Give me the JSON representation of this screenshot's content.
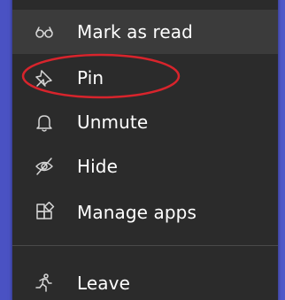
{
  "menu": {
    "items": [
      {
        "label": "Mark as read",
        "icon": "glasses-icon"
      },
      {
        "label": "Pin",
        "icon": "pin-icon"
      },
      {
        "label": "Unmute",
        "icon": "bell-icon"
      },
      {
        "label": "Hide",
        "icon": "eye-off-icon"
      },
      {
        "label": "Manage apps",
        "icon": "apps-icon"
      },
      {
        "label": "Leave",
        "icon": "walk-icon"
      }
    ]
  },
  "colors": {
    "menu_background": "#2b2b2b",
    "hover_background": "#3b3b3b",
    "text": "#ffffff",
    "icon": "#d6d6d6",
    "page_background": "#5159c9",
    "annotation": "#d8242c"
  }
}
